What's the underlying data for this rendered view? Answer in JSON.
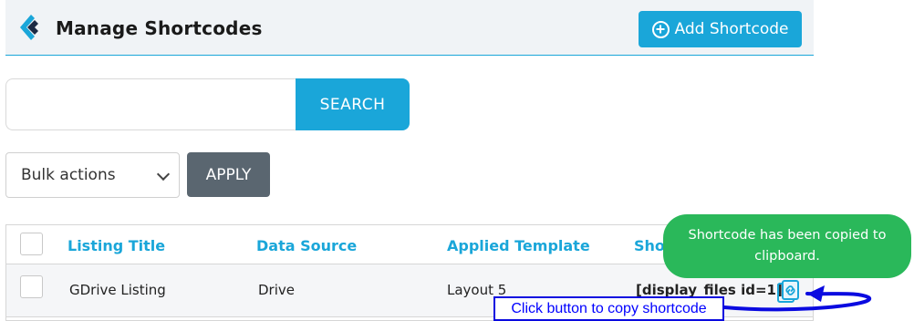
{
  "header": {
    "title": "Manage Shortcodes",
    "add_button_label": "Add Shortcode"
  },
  "search": {
    "value": "",
    "placeholder": "",
    "button_label": "SEARCH"
  },
  "bulk": {
    "selected": "Bulk actions",
    "apply_label": "APPLY"
  },
  "table": {
    "columns": [
      "Listing Title",
      "Data Source",
      "Applied Template",
      "Sho"
    ],
    "rows": [
      {
        "title": "GDrive Listing",
        "source": "Drive",
        "template": "Layout 5",
        "shortcode": "[display_files id=1]"
      }
    ]
  },
  "toast": {
    "message": "Shortcode has been copied to clipboard."
  },
  "annotation": {
    "text": "Click button to copy  shortcode"
  },
  "colors": {
    "accent": "#1aa6d9",
    "apply": "#5a6670",
    "toast": "#2ab85a",
    "annotation": "#0000ff"
  },
  "icons": [
    "logo-icon",
    "plus-circle-icon",
    "chevron-down-icon",
    "copy-link-icon",
    "arrow-icon"
  ]
}
